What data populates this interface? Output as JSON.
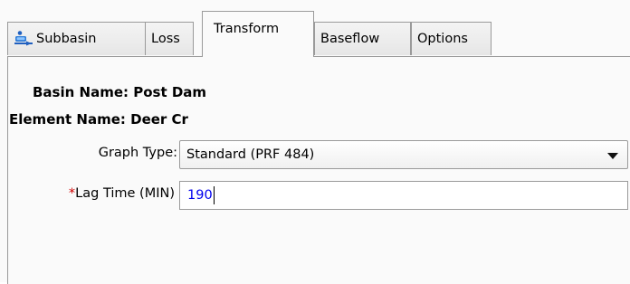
{
  "tabs": [
    {
      "label": "Subbasin",
      "icon": "subbasin-icon"
    },
    {
      "label": "Loss"
    },
    {
      "label": "Transform",
      "active": true
    },
    {
      "label": "Baseflow"
    },
    {
      "label": "Options"
    }
  ],
  "form": {
    "basin_name_line": "Basin Name: Post Dam",
    "element_name_line": "Element Name: Deer Cr",
    "graph_type_label": "Graph Type:",
    "graph_type_value": "Standard (PRF 484)",
    "lag_time_required_marker": "*",
    "lag_time_label": "Lag Time (MIN)",
    "lag_time_value": "190"
  },
  "colors": {
    "required": "#d00000",
    "input_text": "#0000ee"
  }
}
